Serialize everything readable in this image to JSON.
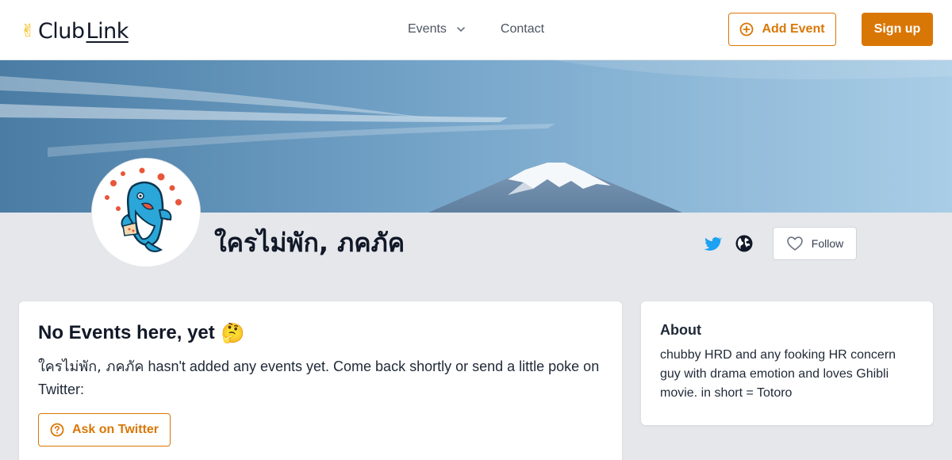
{
  "header": {
    "logo_text_1": "Club",
    "logo_text_2": "Link",
    "logo_icon": "victory-hand-icon",
    "nav": {
      "events_label": "Events",
      "contact_label": "Contact"
    },
    "add_event_label": "Add Event",
    "sign_up_label": "Sign up"
  },
  "profile": {
    "name": "ใครไม่พัก, ภคภัค",
    "follow_label": "Follow",
    "links": [
      "twitter-icon",
      "globe-icon"
    ]
  },
  "events": {
    "title": "No Events here, yet",
    "title_emoji": "🤔",
    "message_name": "ใครไม่พัก, ภคภัค",
    "message_rest": " hasn't added any events yet. Come back shortly or send a little poke on Twitter:",
    "ask_button_label": "Ask on Twitter"
  },
  "about": {
    "title": "About",
    "text": "chubby HRD and any fooking HR concern guy with drama emotion and loves Ghibli movie. in short = Totoro"
  },
  "colors": {
    "accent": "#d97706",
    "twitter": "#1da1f2",
    "page_bg": "#e5e7eb"
  }
}
